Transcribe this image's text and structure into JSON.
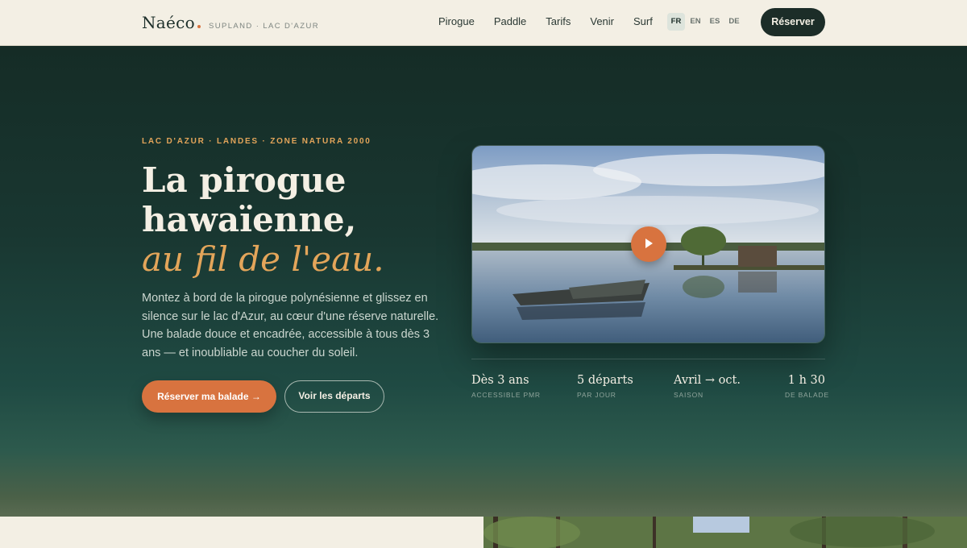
{
  "nav": {
    "brand": "Naéco",
    "brand_sub": "SUPLAND · LAC D'AZUR",
    "links": [
      "Pirogue",
      "Paddle",
      "Tarifs",
      "Venir",
      "Surf"
    ],
    "languages": [
      "FR",
      "EN",
      "ES",
      "DE"
    ],
    "active_language": "FR",
    "reserve_label": "Réserver"
  },
  "hero": {
    "eyebrow": "LAC D'AZUR · LANDES · ZONE NATURA 2000",
    "title": "La pirogue hawaïenne,",
    "title_accent": "au fil de l'eau.",
    "lead": "Montez à bord de la pirogue polynésienne et glissez en silence sur le lac d'Azur, au cœur d'une réserve naturelle. Une balade douce et encadrée, accessible à tous dès 3 ans — et inoubliable au coucher du soleil.",
    "primary_cta": "Réserver ma balade →",
    "secondary_cta": "Voir les départs",
    "media_icon": "play-icon"
  },
  "stats": [
    {
      "value": "Dès 3 ans",
      "label": "ACCESSIBLE PMR"
    },
    {
      "value": "5 départs",
      "label": "PAR JOUR"
    },
    {
      "value": "Avril → oct.",
      "label": "SAISON"
    },
    {
      "value": "1 h 30",
      "label": "DE BALADE"
    }
  ],
  "colors": {
    "accent": "#d8733f",
    "gold": "#e3a55a",
    "dark": "#1c2d28",
    "cream": "#f3efe4"
  }
}
